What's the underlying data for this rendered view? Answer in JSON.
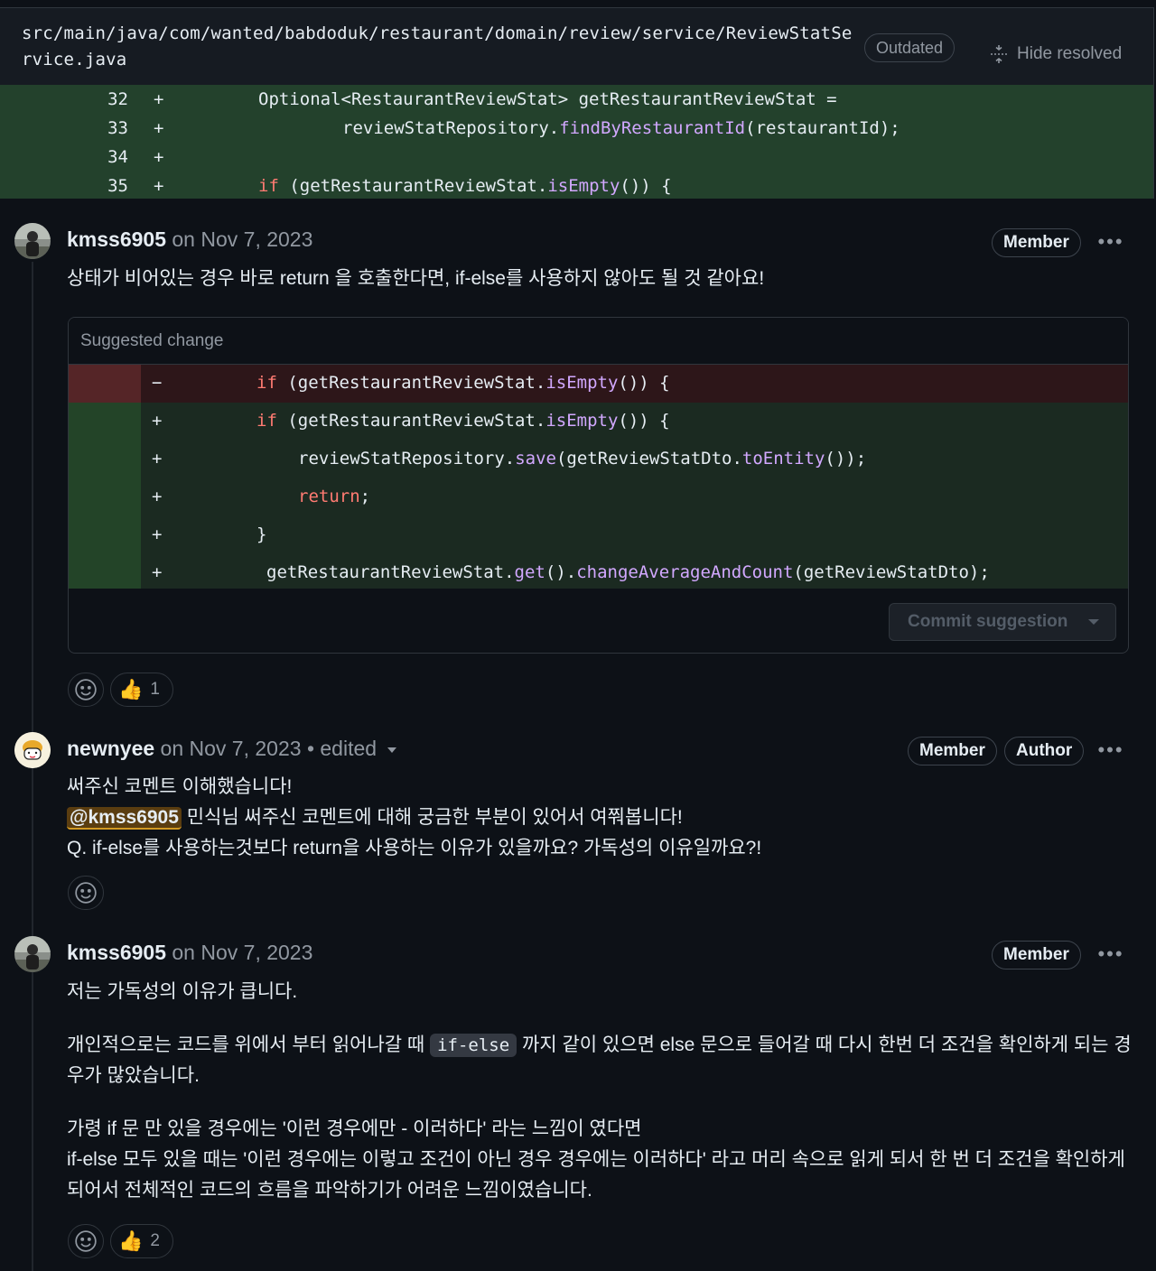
{
  "file": {
    "path": "src/main/java/com/wanted/babdoduk/restaurant/domain/review/service/ReviewStatService.java",
    "outdated_label": "Outdated",
    "hide_resolved_label": "Hide resolved"
  },
  "diff_context": [
    {
      "line": "32",
      "sign": "+"
    },
    {
      "line": "33",
      "sign": "+"
    },
    {
      "line": "34",
      "sign": "+"
    },
    {
      "line": "35",
      "sign": "+"
    }
  ],
  "code_tokens": {
    "optional_decl": "Optional<RestaurantReviewStat> getRestaurantReviewStat =",
    "repo_find_a": "reviewStatRepository.",
    "repo_find_b": "findByRestaurantId",
    "repo_find_c": "(restaurantId);",
    "if_kw": "if",
    "if_cond_a": " (getRestaurantReviewStat.",
    "if_cond_b": "isEmpty",
    "if_cond_c": "()) {",
    "save_a": "reviewStatRepository.",
    "save_b": "save",
    "save_c": "(getReviewStatDto.",
    "save_d": "toEntity",
    "save_e": "());",
    "return_kw": "return",
    "return_semi": ";",
    "close_brace": "}",
    "get_a": "getRestaurantReviewStat.",
    "get_b": "get",
    "get_c": "().",
    "get_d": "changeAverageAndCount",
    "get_e": "(getReviewStatDto);"
  },
  "comments": [
    {
      "author": "kmss6905",
      "date": "on Nov 7, 2023",
      "badge": "Member",
      "body": "상태가 비어있는 경우 바로 return 을 호출한다면, if-else를 사용하지 않아도 될 것 같아요!",
      "suggestion_title": "Suggested change",
      "commit_label": "Commit suggestion",
      "signs": {
        "del": "−",
        "add": "+"
      },
      "reaction_count": "1"
    },
    {
      "author": "newnyee",
      "date": "on Nov 7, 2023",
      "edited": "• edited",
      "badges": [
        "Member",
        "Author"
      ],
      "line1": "써주신 코멘트 이해했습니다!",
      "mention": "@kmss6905",
      "line2_rest": " 민식님 써주신 코멘트에 대해 궁금한 부분이 있어서 여쭤봅니다!",
      "line3": "Q. if-else를 사용하는것보다 return을 사용하는 이유가 있을까요? 가독성의 이유일까요?!"
    },
    {
      "author": "kmss6905",
      "date": "on Nov 7, 2023",
      "badge": "Member",
      "p1": "저는 가독성의 이유가 큽니다.",
      "p2_a": "개인적으로는 코드를 위에서 부터 읽어나갈 때 ",
      "p2_code": "if-else",
      "p2_b": " 까지 같이 있으면 else 문으로 들어갈 때 다시 한번 더 조건을 확인하게 되는 경우가 많았습니다.",
      "p3_l1": "가령 if 문 만 있을 경우에는 '이런 경우에만 - 이러하다' 라는 느낌이 였다면",
      "p3_l2": "if-else 모두 있을 때는 '이런 경우에는 이렇고 조건이 아닌 경우 경우에는 이러하다' 라고 머리 속으로 읽게 되서 한 번 더 조건을 확인하게 되어서 전체적인 코드의 흐름을 파악하기가 어려운 느낌이였습니다.",
      "reaction_count": "2"
    }
  ],
  "colors": {
    "addition": "#23412c",
    "deletion": "#552527",
    "keyword": "#ff7b72",
    "function": "#d2a8ff"
  }
}
